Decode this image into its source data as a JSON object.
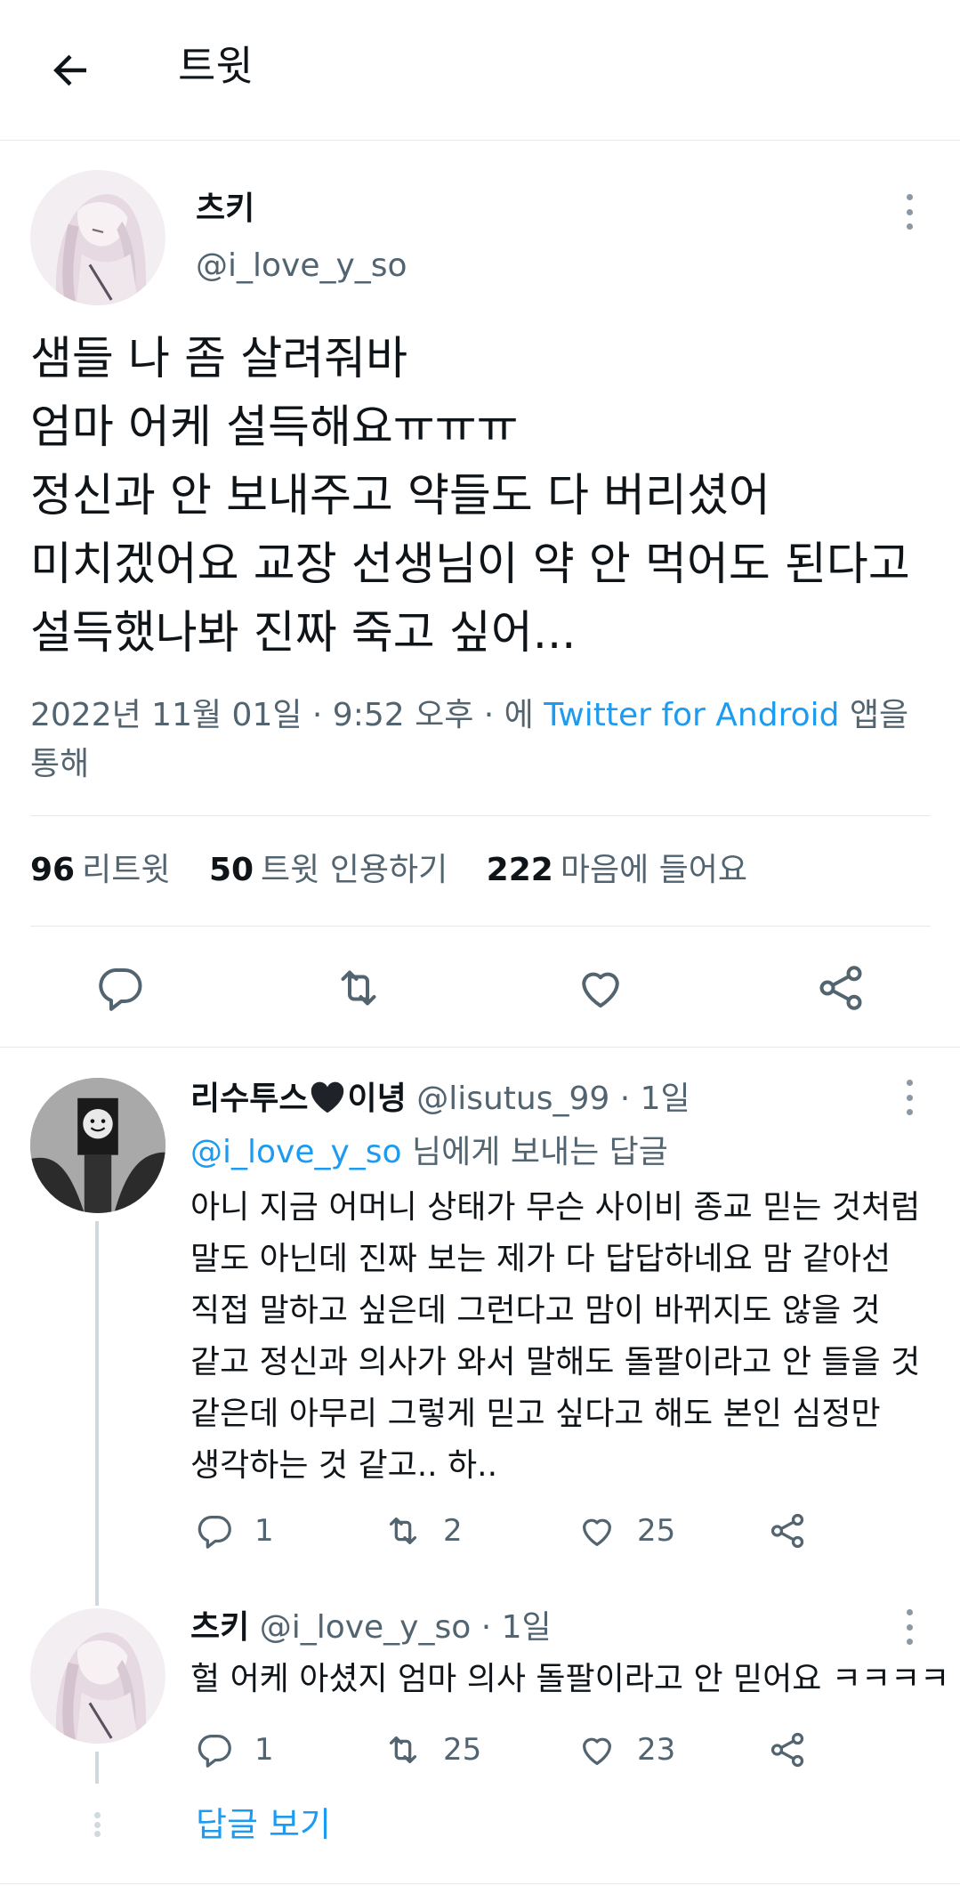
{
  "topbar": {
    "title": "트윗"
  },
  "tweet": {
    "author_name": "츠키",
    "author_handle": "@i_love_y_so",
    "lines": [
      "샘들 나 좀 살려줘바",
      "엄마 어케 설득해요ㅠㅠㅠ",
      "정신과 안 보내주고 약들도 다 버리셨어",
      "미치겠어요 교장 선생님이 약 안 먹어도 된다고",
      "설득했나봐 진짜 죽고 싶어..."
    ],
    "timestamp": "2022년 11월 01일 · 9:52 오후 · 에",
    "source": "Twitter for Android",
    "source_suffix": "앱을",
    "source_suffix2": "통해",
    "stats": {
      "retweets_count": "96",
      "retweets_label": "리트윗",
      "quotes_count": "50",
      "quotes_label": "트윗 인용하기",
      "likes_count": "222",
      "likes_label": "마음에 들어요"
    }
  },
  "reply1": {
    "name_prefix": "리수투스",
    "name_suffix": "이녕",
    "handle": "@lisutus_99",
    "time": "· 1일",
    "replying_to_handle": "@i_love_y_so",
    "replying_to_label": "님에게 보내는 답글",
    "lines": [
      "아니 지금 어머니 상태가 무슨 사이비 종교 믿는 것처럼",
      "말도 아닌데 진짜 보는 제가 다 답답하네요 맘 같아선",
      "직접 말하고 싶은데 그런다고 맘이 바뀌지도 않을 것",
      "같고 정신과 의사가 와서 말해도 돌팔이라고 안 들을 것",
      "같은데 아무리 그렇게 믿고 싶다고 해도 본인 심정만",
      "생각하는 것 같고.. 하.."
    ],
    "replies": "1",
    "retweets": "2",
    "likes": "25"
  },
  "reply2": {
    "name": "츠키",
    "handle": "@i_love_y_so",
    "time": "· 1일",
    "text": "헐 어케 아셨지 엄마 의사 돌팔이라고 안 믿어요 ㅋㅋㅋㅋ",
    "replies": "1",
    "retweets": "25",
    "likes": "23"
  },
  "show_replies": "답글 보기",
  "colors": {
    "accent": "#1d9bf0",
    "secondary_text": "#536471",
    "divider": "#e7e9ea",
    "icon": "#536471"
  },
  "icons": [
    "back-arrow-icon",
    "more-icon",
    "reply-icon",
    "retweet-icon",
    "like-icon",
    "share-icon",
    "black-heart-icon"
  ]
}
